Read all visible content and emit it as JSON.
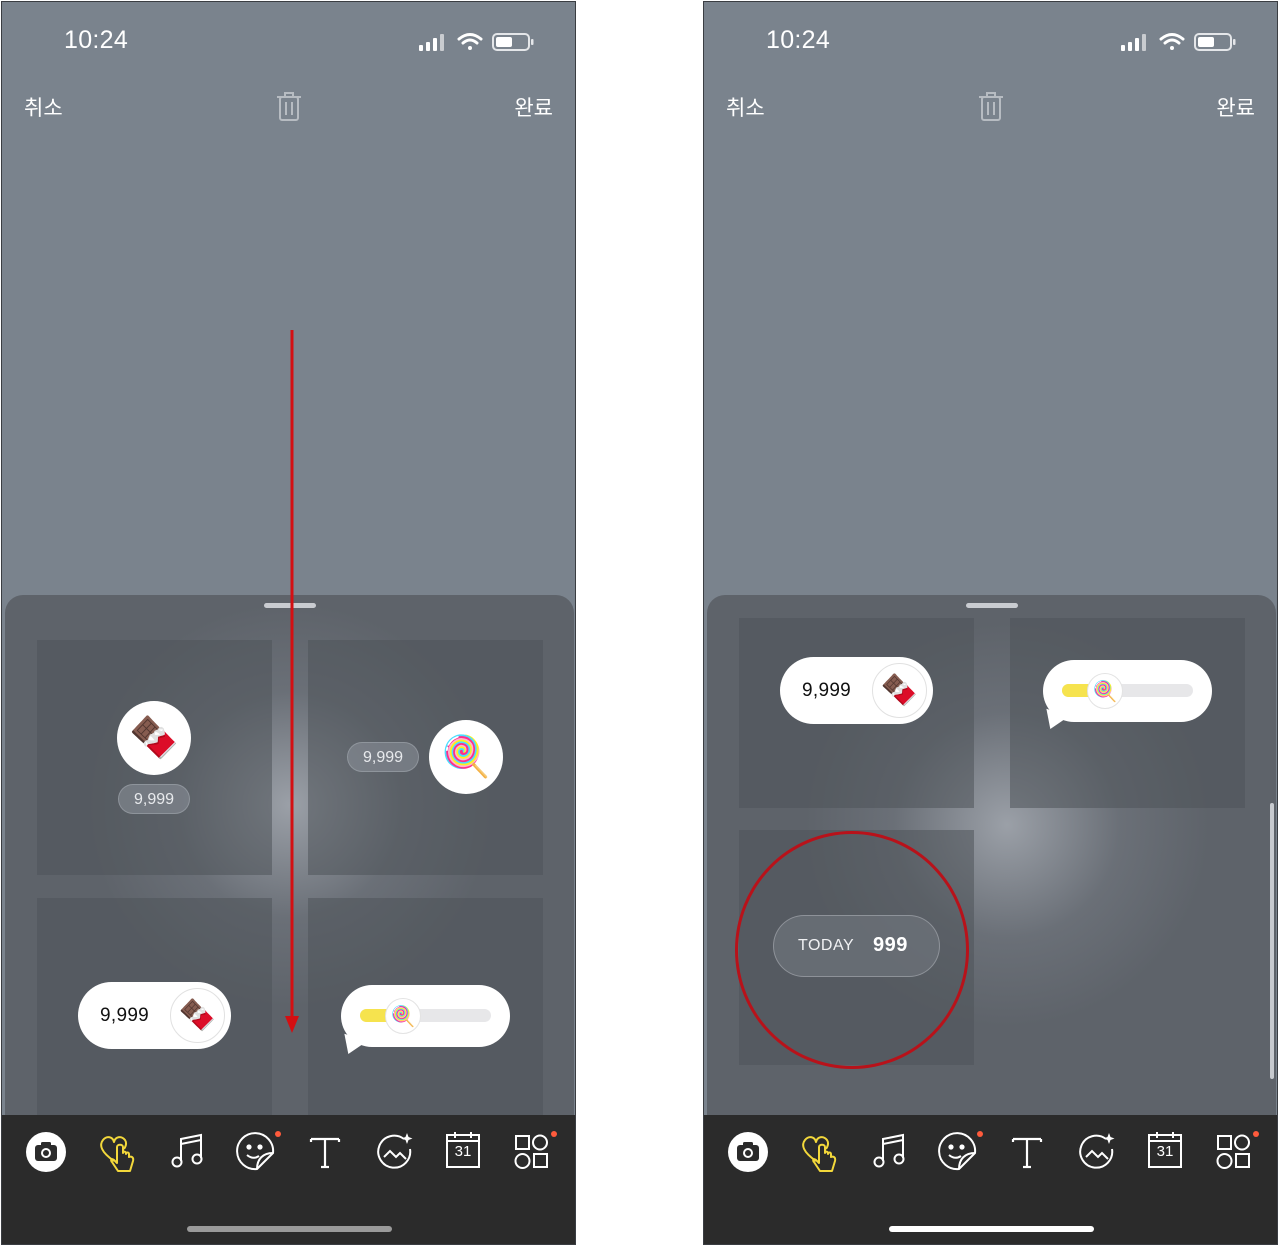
{
  "status_bar": {
    "time": "10:24"
  },
  "nav": {
    "cancel": "취소",
    "done": "완료"
  },
  "left_screen": {
    "sticker_chocolate_count": "9,999",
    "sticker_lollipop_count": "9,999",
    "pill_chocolate_count": "9,999",
    "slider_fill": 0.33
  },
  "right_screen": {
    "pill_chocolate_count": "9,999",
    "slider_fill": 0.33,
    "today": {
      "label": "TODAY",
      "value": "999"
    }
  },
  "emoji": {
    "chocolate": "🍫",
    "lollipop": "🍭"
  },
  "toolbar": {
    "items": [
      "camera-icon",
      "heart-tap-icon",
      "music-note-icon",
      "sticker-icon",
      "text-icon",
      "magic-photo-icon",
      "calendar-icon",
      "widgets-icon"
    ],
    "calendar_day": "31",
    "active_color": "#f3d83b",
    "badge_color": "#ff5b3c"
  },
  "annotation_color": "#d40f12"
}
